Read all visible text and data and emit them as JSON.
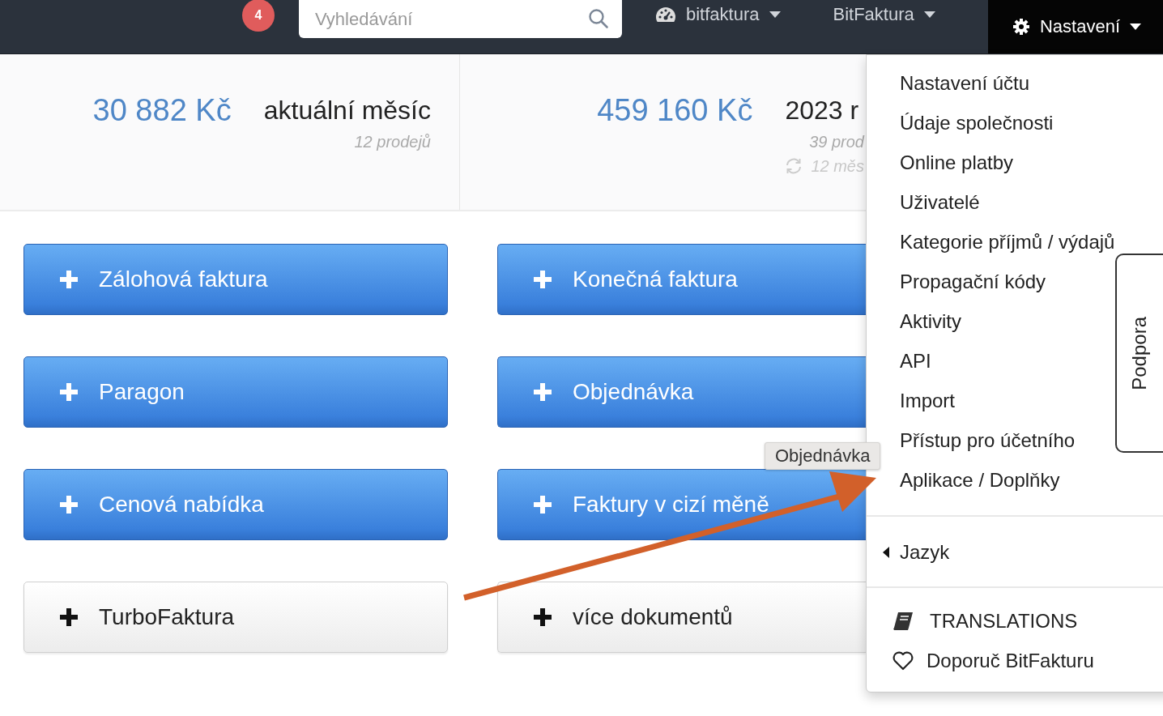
{
  "navbar": {
    "notification_count": "4",
    "search": {
      "placeholder": "Vyhledávání"
    },
    "menus": [
      {
        "label": "bitfaktura",
        "kind": "dashboard",
        "selected": false
      },
      {
        "label": "BitFaktura",
        "kind": "plain",
        "selected": false
      },
      {
        "label": "Nastavení",
        "kind": "settings",
        "selected": true
      }
    ]
  },
  "stats": [
    {
      "amount": "30 882 Kč",
      "period": "aktuální měsíc",
      "lines": [
        {
          "text": "12 prodejů",
          "kind": "plain"
        }
      ]
    },
    {
      "amount": "459 160 Kč",
      "period": "2023 r",
      "lines": [
        {
          "text": "39 prod",
          "kind": "plain"
        },
        {
          "text": "12 měs",
          "kind": "refresh"
        }
      ]
    }
  ],
  "actions": [
    {
      "label": "Zálohová faktura",
      "kind": "primary"
    },
    {
      "label": "Konečná faktura",
      "kind": "primary"
    },
    {
      "label": "Paragon",
      "kind": "primary"
    },
    {
      "label": "Objednávka",
      "kind": "primary"
    },
    {
      "label": "Cenová nabídka",
      "kind": "primary"
    },
    {
      "label": "Faktury v cizí měně",
      "kind": "primary"
    },
    {
      "label": "TurboFaktura",
      "kind": "secondary"
    },
    {
      "label": "více dokumentů",
      "kind": "secondary"
    }
  ],
  "settings_menu": {
    "sections": [
      {
        "items": [
          {
            "label": "Nastavení účtu",
            "kind": "plain"
          },
          {
            "label": "Údaje společnosti",
            "kind": "plain"
          },
          {
            "label": "Online platby",
            "kind": "plain"
          },
          {
            "label": "Uživatelé",
            "kind": "plain"
          },
          {
            "label": "Kategorie příjmů / výdajů",
            "kind": "plain"
          },
          {
            "label": "Propagační kódy",
            "kind": "plain"
          },
          {
            "label": "Aktivity",
            "kind": "plain"
          },
          {
            "label": "API",
            "kind": "plain"
          },
          {
            "label": "Import",
            "kind": "plain"
          },
          {
            "label": "Přístup pro účetního",
            "kind": "plain"
          },
          {
            "label": "Aplikace / Doplňky",
            "kind": "plain"
          }
        ]
      },
      {
        "items": [
          {
            "label": "Jazyk",
            "kind": "submenu"
          }
        ]
      },
      {
        "items": [
          {
            "label": "TRANSLATIONS",
            "kind": "book"
          },
          {
            "label": "Doporuč BitFakturu",
            "kind": "heart"
          }
        ]
      }
    ]
  },
  "tooltip": "Objednávka",
  "support_tab": "Podpora"
}
